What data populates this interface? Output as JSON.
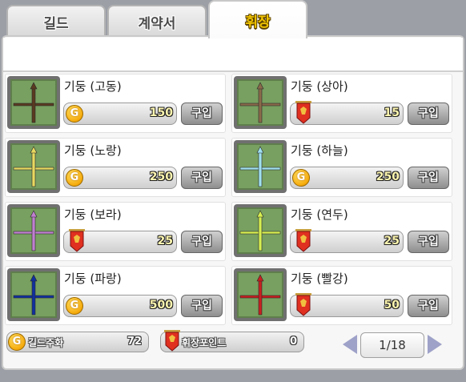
{
  "tabs": [
    {
      "label": "길드",
      "active": false
    },
    {
      "label": "계약서",
      "active": false
    },
    {
      "label": "휘장",
      "active": true
    }
  ],
  "colors": {
    "gold": "#f0c400",
    "panel": "#f7f7f7",
    "icon_bg": "#78a060"
  },
  "items": [
    {
      "name": "기둥 (고동)",
      "currency": "coin-icon",
      "price": "150",
      "buy_label": "구입",
      "color": "#5a3a20"
    },
    {
      "name": "기둥 (상아)",
      "currency": "banner-icon",
      "price": "15",
      "buy_label": "구입",
      "color": "#8a6a4a"
    },
    {
      "name": "기둥 (노랑)",
      "currency": "coin-icon",
      "price": "250",
      "buy_label": "구입",
      "color": "#e8d860"
    },
    {
      "name": "기둥 (하늘)",
      "currency": "coin-icon",
      "price": "250",
      "buy_label": "구입",
      "color": "#a0e0f0"
    },
    {
      "name": "기둥 (보라)",
      "currency": "banner-icon",
      "price": "25",
      "buy_label": "구입",
      "color": "#c080d0"
    },
    {
      "name": "기둥 (연두)",
      "currency": "banner-icon",
      "price": "25",
      "buy_label": "구입",
      "color": "#d8f050"
    },
    {
      "name": "기둥 (파랑)",
      "currency": "coin-icon",
      "price": "500",
      "buy_label": "구입",
      "color": "#1030a0"
    },
    {
      "name": "기둥 (빨강)",
      "currency": "banner-icon",
      "price": "50",
      "buy_label": "구입",
      "color": "#c82020"
    }
  ],
  "footer": {
    "guild_currency_label": "길드주화",
    "guild_currency_value": "72",
    "emblem_points_label": "휘장포인트",
    "emblem_points_value": "0",
    "page": "1/18"
  }
}
